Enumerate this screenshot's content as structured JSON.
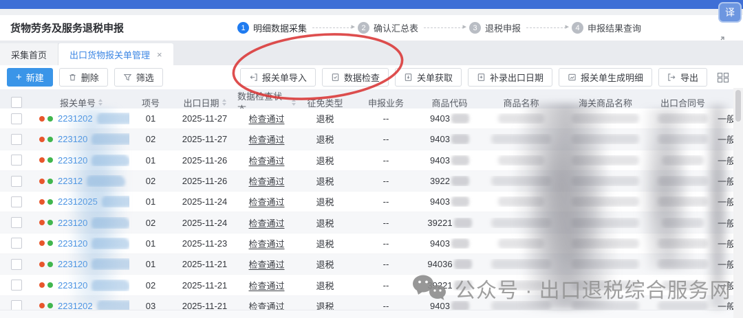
{
  "app": {
    "translate_badge": "译"
  },
  "header": {
    "title": "货物劳务及服务退税申报",
    "steps": [
      {
        "num": "1",
        "label": "明细数据采集"
      },
      {
        "num": "2",
        "label": "确认汇总表"
      },
      {
        "num": "3",
        "label": "退税申报"
      },
      {
        "num": "4",
        "label": "申报结果查询"
      }
    ]
  },
  "tabs": {
    "home": "采集首页",
    "active": "出口货物报关单管理",
    "close": "×"
  },
  "toolbar": {
    "new": "新建",
    "delete": "删除",
    "filter": "筛选",
    "import": "报关单导入",
    "check": "数据检查",
    "fetch": "关单获取",
    "supplement": "补录出口日期",
    "generate": "报关单生成明细",
    "export": "导出"
  },
  "table": {
    "headers": {
      "declaration_no": "报关单号",
      "item_no": "项号",
      "export_date": "出口日期",
      "check_status": "数据检查状态",
      "tax_type": "征免类型",
      "declare_business": "申报业务",
      "commodity_code": "商品代码",
      "commodity_name": "商品名称",
      "customs_name": "海关商品名称",
      "contract_no": "出口合同号"
    },
    "rows": [
      {
        "declaration_no": "2231202",
        "item_no": "01",
        "export_date": "2025-11-27",
        "check_status": "检查通过",
        "tax_type": "退税",
        "declare_business": "--",
        "commodity_code": "9403",
        "trade": "一般"
      },
      {
        "declaration_no": "223120",
        "item_no": "02",
        "export_date": "2025-11-27",
        "check_status": "检查通过",
        "tax_type": "退税",
        "declare_business": "--",
        "commodity_code": "9403",
        "trade": "一般"
      },
      {
        "declaration_no": "223120",
        "item_no": "01",
        "export_date": "2025-11-26",
        "check_status": "检查通过",
        "tax_type": "退税",
        "declare_business": "--",
        "commodity_code": "9403",
        "trade": "一般"
      },
      {
        "declaration_no": "22312",
        "item_no": "02",
        "export_date": "2025-11-26",
        "check_status": "检查通过",
        "tax_type": "退税",
        "declare_business": "--",
        "commodity_code": "3922",
        "trade": "一般"
      },
      {
        "declaration_no": "22312025",
        "item_no": "01",
        "export_date": "2025-11-24",
        "check_status": "检查通过",
        "tax_type": "退税",
        "declare_business": "--",
        "commodity_code": "9403",
        "trade": "一般"
      },
      {
        "declaration_no": "223120",
        "item_no": "02",
        "export_date": "2025-11-24",
        "check_status": "检查通过",
        "tax_type": "退税",
        "declare_business": "--",
        "commodity_code": "39221",
        "trade": "一般"
      },
      {
        "declaration_no": "223120",
        "item_no": "01",
        "export_date": "2025-11-23",
        "check_status": "检查通过",
        "tax_type": "退税",
        "declare_business": "--",
        "commodity_code": "9403",
        "trade": "一般"
      },
      {
        "declaration_no": "223120",
        "item_no": "01",
        "export_date": "2025-11-21",
        "check_status": "检查通过",
        "tax_type": "退税",
        "declare_business": "--",
        "commodity_code": "94036",
        "trade": "一般"
      },
      {
        "declaration_no": "223120",
        "item_no": "02",
        "export_date": "2025-11-21",
        "check_status": "检查通过",
        "tax_type": "退税",
        "declare_business": "--",
        "commodity_code": "39221",
        "trade": "一般"
      },
      {
        "declaration_no": "2231202",
        "item_no": "03",
        "export_date": "2025-11-21",
        "check_status": "检查通过",
        "tax_type": "退税",
        "declare_business": "--",
        "commodity_code": "9403",
        "trade": "一般"
      }
    ]
  },
  "watermark": {
    "text": "公众号 · 出口退税综合服务网"
  },
  "colors": {
    "topbar_blue": "#3e6fd6",
    "accent_blue": "#3a95e8",
    "link_blue": "#4b94e4",
    "step_active": "#1f7bf0",
    "annotation_red": "#d93535",
    "dot_orange": "#e8562c",
    "dot_green": "#41b64e"
  }
}
